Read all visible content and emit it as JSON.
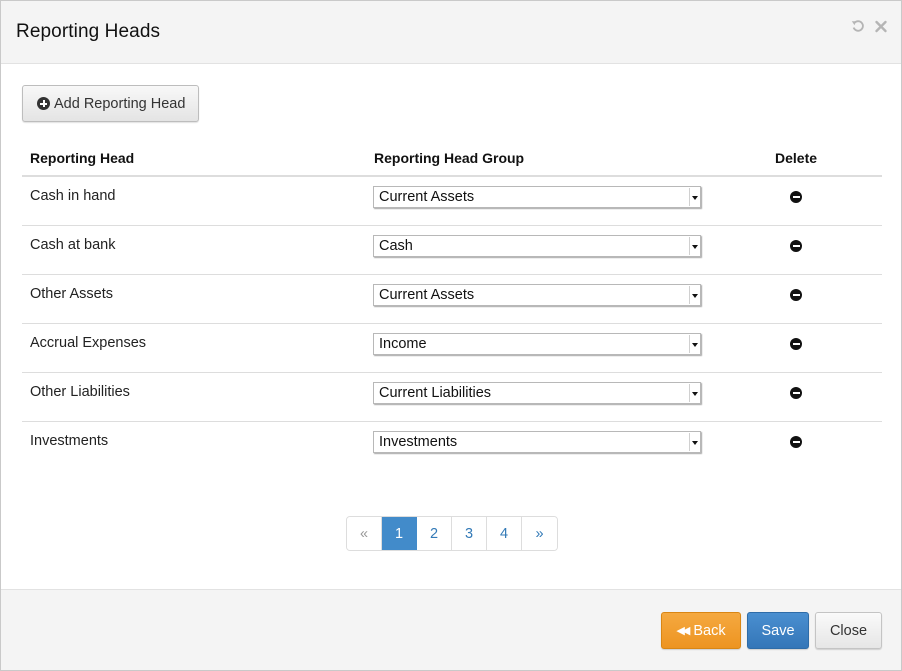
{
  "modal": {
    "title": "Reporting Heads",
    "header_icons": [
      "reset-icon",
      "close-icon"
    ]
  },
  "toolbar": {
    "add_label": "Add Reporting Head",
    "add_icon": "plus-circle-icon"
  },
  "table": {
    "columns": [
      "Reporting Head",
      "Reporting Head Group",
      "Delete"
    ],
    "rows": [
      {
        "name": "Cash in hand",
        "group": "Current Assets"
      },
      {
        "name": "Cash at bank",
        "group": "Cash"
      },
      {
        "name": "Other Assets",
        "group": "Current Assets"
      },
      {
        "name": "Accrual Expenses",
        "group": "Income"
      },
      {
        "name": "Other Liabilities",
        "group": "Current Liabilities"
      },
      {
        "name": "Investments",
        "group": "Investments"
      }
    ],
    "delete_icon": "minus-circle-icon"
  },
  "pagination": {
    "prev": "«",
    "pages": [
      "1",
      "2",
      "3",
      "4"
    ],
    "next": "»",
    "current": "1"
  },
  "footer": {
    "back_label": "Back",
    "back_icon": "fast-backward-icon",
    "save_label": "Save",
    "close_label": "Close"
  },
  "colors": {
    "back": "#f0a030",
    "save": "#3a7dc0",
    "page_active": "#428bca",
    "page_link": "#337ab7"
  }
}
